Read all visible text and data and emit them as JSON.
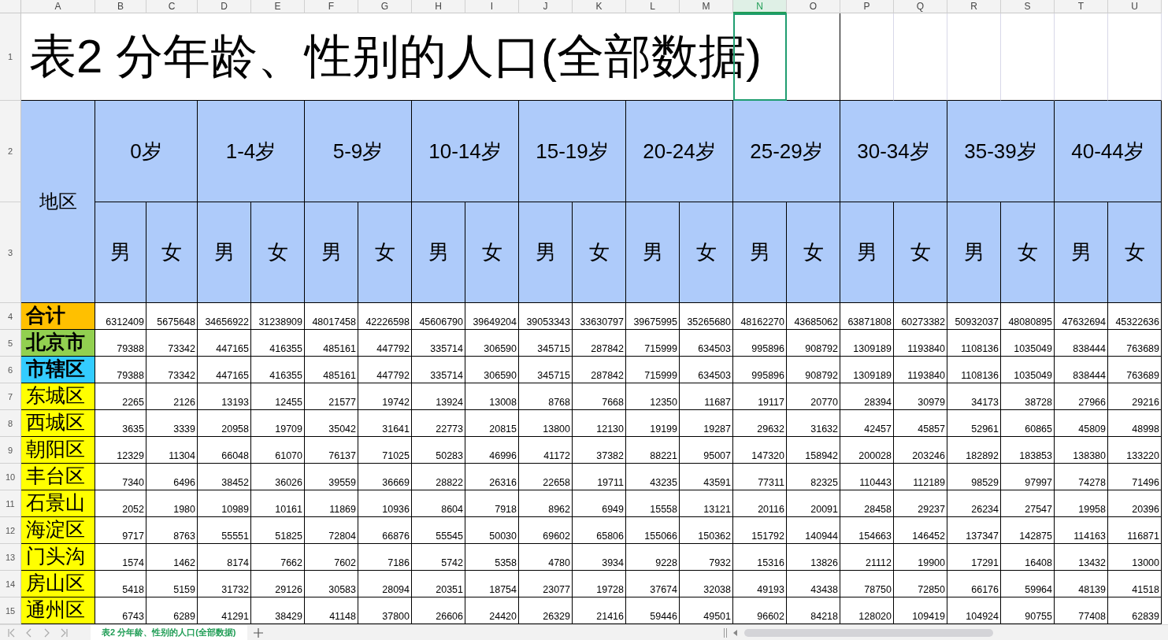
{
  "columns": [
    {
      "label": "A",
      "selected": false
    },
    {
      "label": "B",
      "selected": false
    },
    {
      "label": "C",
      "selected": false
    },
    {
      "label": "D",
      "selected": false
    },
    {
      "label": "E",
      "selected": false
    },
    {
      "label": "F",
      "selected": false
    },
    {
      "label": "G",
      "selected": false
    },
    {
      "label": "H",
      "selected": false
    },
    {
      "label": "I",
      "selected": false
    },
    {
      "label": "J",
      "selected": false
    },
    {
      "label": "K",
      "selected": false
    },
    {
      "label": "L",
      "selected": false
    },
    {
      "label": "M",
      "selected": false
    },
    {
      "label": "N",
      "selected": true
    },
    {
      "label": "O",
      "selected": false
    },
    {
      "label": "P",
      "selected": false
    },
    {
      "label": "Q",
      "selected": false
    },
    {
      "label": "R",
      "selected": false
    },
    {
      "label": "S",
      "selected": false
    },
    {
      "label": "T",
      "selected": false
    },
    {
      "label": "U",
      "selected": false
    }
  ],
  "row_numbers": [
    "1",
    "2",
    "3",
    "4",
    "5",
    "6",
    "7",
    "8",
    "9",
    "10",
    "11",
    "12",
    "13",
    "14",
    "15"
  ],
  "title": "表2 分年龄、性别的人口(全部数据)",
  "region_header": "地区",
  "age_groups": [
    "0岁",
    "1-4岁",
    "5-9岁",
    "10-14岁",
    "15-19岁",
    "20-24岁",
    "25-29岁",
    "30-34岁",
    "35-39岁",
    "40-44岁"
  ],
  "sexes": [
    "男",
    "女",
    "男",
    "女",
    "男",
    "女",
    "男",
    "女",
    "男",
    "女",
    "男",
    "女",
    "男",
    "女",
    "男",
    "女",
    "男",
    "女",
    "男",
    "女"
  ],
  "rows": [
    {
      "label": "合计",
      "color": "#ffc000",
      "bold": true,
      "values": [
        "6312409",
        "5675648",
        "34656922",
        "31238909",
        "48017458",
        "42226598",
        "45606790",
        "39649204",
        "39053343",
        "33630797",
        "39675995",
        "35265680",
        "48162270",
        "43685062",
        "63871808",
        "60273382",
        "50932037",
        "48080895",
        "47632694",
        "45322636"
      ]
    },
    {
      "label": "北京市",
      "color": "#92d050",
      "bold": true,
      "values": [
        "79388",
        "73342",
        "447165",
        "416355",
        "485161",
        "447792",
        "335714",
        "306590",
        "345715",
        "287842",
        "715999",
        "634503",
        "995896",
        "908792",
        "1309189",
        "1193840",
        "1108136",
        "1035049",
        "838444",
        "763689"
      ]
    },
    {
      "label": "市辖区",
      "color": "#33ccff",
      "bold": true,
      "values": [
        "79388",
        "73342",
        "447165",
        "416355",
        "485161",
        "447792",
        "335714",
        "306590",
        "345715",
        "287842",
        "715999",
        "634503",
        "995896",
        "908792",
        "1309189",
        "1193840",
        "1108136",
        "1035049",
        "838444",
        "763689"
      ]
    },
    {
      "label": "东城区",
      "color": "#ffff00",
      "bold": false,
      "values": [
        "2265",
        "2126",
        "13193",
        "12455",
        "21577",
        "19742",
        "13924",
        "13008",
        "8768",
        "7668",
        "12350",
        "11687",
        "19117",
        "20770",
        "28394",
        "30979",
        "34173",
        "38728",
        "27966",
        "29216"
      ]
    },
    {
      "label": "西城区",
      "color": "#ffff00",
      "bold": false,
      "values": [
        "3635",
        "3339",
        "20958",
        "19709",
        "35042",
        "31641",
        "22773",
        "20815",
        "13800",
        "12130",
        "19199",
        "19287",
        "29632",
        "31632",
        "42457",
        "45857",
        "52961",
        "60865",
        "45809",
        "48998"
      ]
    },
    {
      "label": "朝阳区",
      "color": "#ffff00",
      "bold": false,
      "values": [
        "12329",
        "11304",
        "66048",
        "61070",
        "76137",
        "71025",
        "50283",
        "46996",
        "41172",
        "37382",
        "88221",
        "95007",
        "147320",
        "158942",
        "200028",
        "203246",
        "182892",
        "183853",
        "138380",
        "133220"
      ]
    },
    {
      "label": "丰台区",
      "color": "#ffff00",
      "bold": false,
      "values": [
        "7340",
        "6496",
        "38452",
        "36026",
        "39559",
        "36669",
        "28822",
        "26316",
        "22658",
        "19711",
        "43235",
        "43591",
        "77311",
        "82325",
        "110443",
        "112189",
        "98529",
        "97997",
        "74278",
        "71496"
      ]
    },
    {
      "label": "石景山",
      "color": "#ffff00",
      "bold": false,
      "values": [
        "2052",
        "1980",
        "10989",
        "10161",
        "11869",
        "10936",
        "8604",
        "7918",
        "8962",
        "6949",
        "15558",
        "13121",
        "20116",
        "20091",
        "28458",
        "29237",
        "26234",
        "27547",
        "19958",
        "20396"
      ]
    },
    {
      "label": "海淀区",
      "color": "#ffff00",
      "bold": false,
      "values": [
        "9717",
        "8763",
        "55551",
        "51825",
        "72804",
        "66876",
        "55545",
        "50030",
        "69602",
        "65806",
        "155066",
        "150362",
        "151792",
        "140944",
        "154663",
        "146452",
        "137347",
        "142875",
        "114163",
        "116871"
      ]
    },
    {
      "label": "门头沟",
      "color": "#ffff00",
      "bold": false,
      "values": [
        "1574",
        "1462",
        "8174",
        "7662",
        "7602",
        "7186",
        "5742",
        "5358",
        "4780",
        "3934",
        "9228",
        "7932",
        "15316",
        "13826",
        "21112",
        "19900",
        "17291",
        "16408",
        "13432",
        "13000"
      ]
    },
    {
      "label": "房山区",
      "color": "#ffff00",
      "bold": false,
      "values": [
        "5418",
        "5159",
        "31732",
        "29126",
        "30583",
        "28094",
        "20351",
        "18754",
        "23077",
        "19728",
        "37674",
        "32038",
        "49193",
        "43438",
        "78750",
        "72850",
        "66176",
        "59964",
        "48139",
        "41518"
      ]
    },
    {
      "label": "通州区",
      "color": "#ffff00",
      "bold": false,
      "values": [
        "6743",
        "6289",
        "41291",
        "38429",
        "41148",
        "37800",
        "26606",
        "24420",
        "26329",
        "21416",
        "59446",
        "49501",
        "96602",
        "84218",
        "128020",
        "109419",
        "104924",
        "90755",
        "77408",
        "62839"
      ]
    }
  ],
  "sheet_tabs": [
    {
      "label": "表2 分年龄、性别的人口(全部数据)",
      "selected": true
    }
  ]
}
